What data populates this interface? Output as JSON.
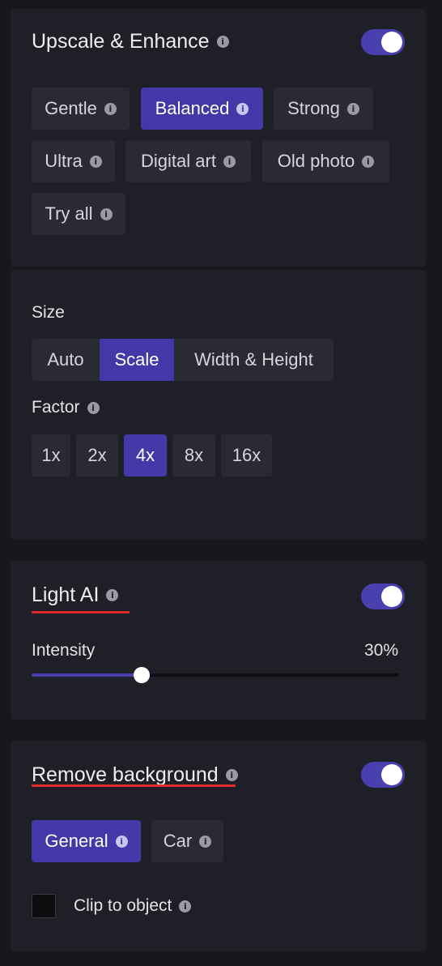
{
  "upscale": {
    "title": "Upscale & Enhance",
    "enabled": true,
    "modes": [
      {
        "label": "Gentle",
        "active": false
      },
      {
        "label": "Balanced",
        "active": true
      },
      {
        "label": "Strong",
        "active": false
      },
      {
        "label": "Ultra",
        "active": false
      },
      {
        "label": "Digital art",
        "active": false
      },
      {
        "label": "Old photo",
        "active": false
      },
      {
        "label": "Try all",
        "active": false
      }
    ]
  },
  "size": {
    "label": "Size",
    "options": [
      {
        "label": "Auto",
        "active": false
      },
      {
        "label": "Scale",
        "active": true
      },
      {
        "label": "Width & Height",
        "active": false
      }
    ],
    "factor_label": "Factor",
    "factors": [
      {
        "label": "1x",
        "active": false
      },
      {
        "label": "2x",
        "active": false
      },
      {
        "label": "4x",
        "active": true
      },
      {
        "label": "8x",
        "active": false
      },
      {
        "label": "16x",
        "active": false
      }
    ]
  },
  "light_ai": {
    "title": "Light AI",
    "enabled": true,
    "intensity_label": "Intensity",
    "intensity_value": "30%",
    "intensity_fraction": 0.3
  },
  "remove_bg": {
    "title": "Remove background",
    "enabled": true,
    "modes": [
      {
        "label": "General",
        "active": true
      },
      {
        "label": "Car",
        "active": false
      }
    ],
    "clip_label": "Clip to object",
    "clip_checked": false
  },
  "icons": {
    "info": "i",
    "accent": "#4437a8",
    "annotation_underline": "#e02b2b"
  }
}
